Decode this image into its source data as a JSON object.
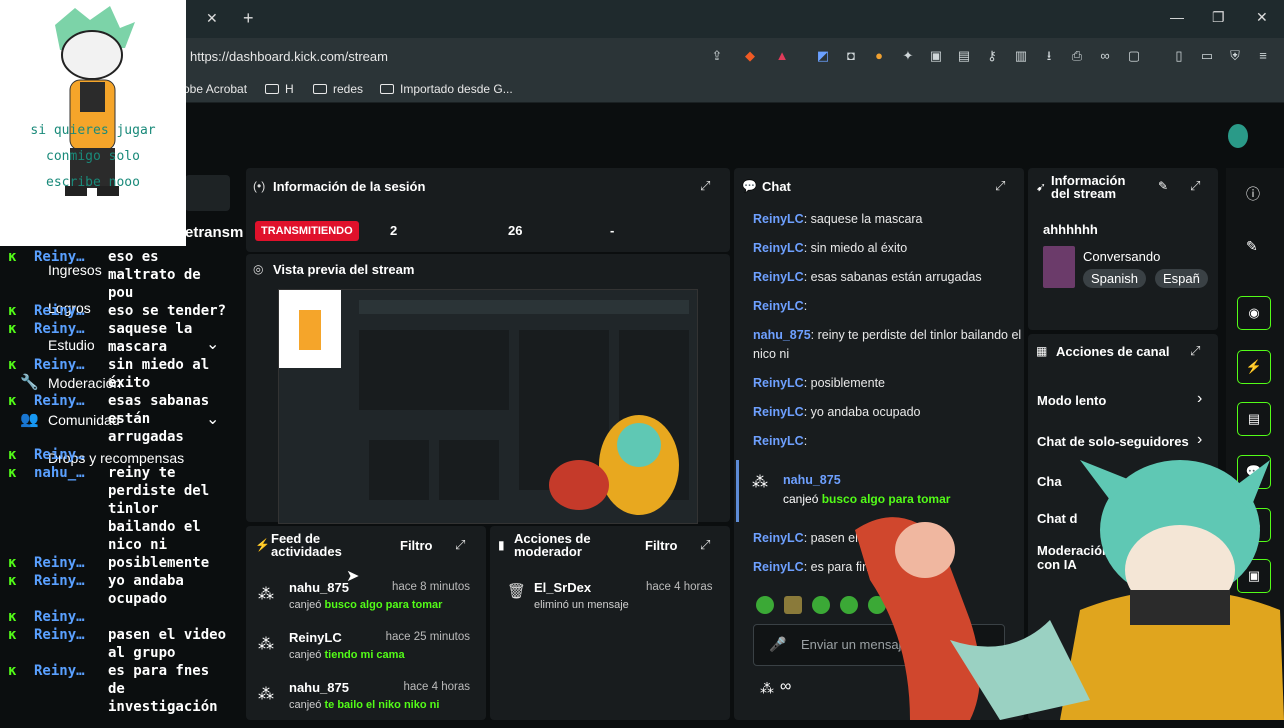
{
  "browser": {
    "url": "https://dashboard.kick.com/stream",
    "tab_close": "✕",
    "new_tab": "+",
    "bookmarks": [
      "obe Acrobat",
      "H",
      "redes",
      "Importado desde G..."
    ]
  },
  "avatar_overlay": {
    "caption_line1": "si quieres jugar",
    "caption_line2": "conmigo solo",
    "caption_line3": "escribe nooo"
  },
  "sidebar": {
    "partial_label": "etransm",
    "items": [
      {
        "label": "Ingresos"
      },
      {
        "label": "Logros"
      },
      {
        "label": "Estudio"
      },
      {
        "label": "Moderación"
      },
      {
        "label": "Comunidad"
      },
      {
        "label": "Drops y recompensas"
      }
    ]
  },
  "overlay_chat": [
    {
      "name": "Reiny…",
      "text": "eso es"
    },
    {
      "name": "",
      "text": "maltrato de"
    },
    {
      "name": "",
      "text": "pou"
    },
    {
      "name": "Reiny…",
      "text": "eso se tender?"
    },
    {
      "name": "Reiny…",
      "text": "saquese la"
    },
    {
      "name": "",
      "text": "mascara"
    },
    {
      "name": "Reiny…",
      "text": "sin miedo al"
    },
    {
      "name": "",
      "text": "éxito"
    },
    {
      "name": "Reiny…",
      "text": "esas sabanas"
    },
    {
      "name": "",
      "text": "están"
    },
    {
      "name": "",
      "text": "arrugadas"
    },
    {
      "name": "Reiny…",
      "text": ""
    },
    {
      "name": "nahu_…",
      "text": "reiny te"
    },
    {
      "name": "",
      "text": "perdiste del"
    },
    {
      "name": "",
      "text": "tinlor"
    },
    {
      "name": "",
      "text": "bailando el"
    },
    {
      "name": "",
      "text": "nico ni"
    },
    {
      "name": "Reiny…",
      "text": "posiblemente"
    },
    {
      "name": "Reiny…",
      "text": "yo andaba"
    },
    {
      "name": "",
      "text": "ocupado"
    },
    {
      "name": "Reiny…",
      "text": ""
    },
    {
      "name": "Reiny…",
      "text": "pasen el video"
    },
    {
      "name": "",
      "text": "al grupo"
    },
    {
      "name": "Reiny…",
      "text": "es para fnes"
    },
    {
      "name": "",
      "text": "de"
    },
    {
      "name": "",
      "text": "investigación"
    }
  ],
  "session": {
    "title": "Información de la sesión",
    "live_badge": "TRANSMITIENDO",
    "stat1": "2",
    "stat2": "26",
    "stat3": "-"
  },
  "preview": {
    "title": "Vista previa del stream"
  },
  "activity_feed": {
    "title_line1": "Feed de",
    "title_line2": "actividades",
    "filter": "Filtro",
    "items": [
      {
        "name": "nahu_875",
        "time": "hace 8 minutos",
        "sub": "canjeó",
        "reward": "busco algo para tomar"
      },
      {
        "name": "ReinyLC",
        "time": "hace 25 minutos",
        "sub": "canjeó",
        "reward": "tiendo mi cama"
      },
      {
        "name": "nahu_875",
        "time": "hace 4 horas",
        "sub": "canjeó",
        "reward": "te bailo el niko niko ni"
      }
    ]
  },
  "mod_actions": {
    "title_line1": "Acciones de",
    "title_line2": "moderador",
    "filter": "Filtro",
    "items": [
      {
        "name": "El_SrDex",
        "time": "hace 4 horas",
        "sub": "eliminó un mensaje"
      }
    ]
  },
  "chat": {
    "title": "Chat",
    "messages": [
      {
        "user": "ReinyLC",
        "text": ": saquese la mascara"
      },
      {
        "user": "ReinyLC",
        "text": ": sin miedo al éxito"
      },
      {
        "user": "ReinyLC",
        "text": ": esas sabanas están arrugadas"
      },
      {
        "user": "ReinyLC",
        "text": ":"
      },
      {
        "user": "nahu_875",
        "text": ": reiny te perdiste del tinlor bailando el nico ni"
      },
      {
        "user": "ReinyLC",
        "text": ": posiblemente"
      },
      {
        "user": "ReinyLC",
        "text": ": yo andaba ocupado"
      },
      {
        "user": "ReinyLC",
        "text": ":"
      }
    ],
    "redeem": {
      "user": "nahu_875",
      "text": "canjeó",
      "reward": "busco algo para tomar"
    },
    "messages2": [
      {
        "user": "ReinyLC",
        "text": ": pasen el vid"
      },
      {
        "user": "ReinyLC",
        "text": ": es para fin"
      }
    ],
    "input_placeholder": "Enviar un mensaje",
    "points": "∞"
  },
  "stream_info": {
    "title_line1": "Información",
    "title_line2": "del stream",
    "stream_title": "ahhhhhh",
    "category": "Conversando",
    "tags": [
      "Spanish",
      "Españ"
    ]
  },
  "channel_actions": {
    "title": "Acciones de canal",
    "rows": [
      "Modo lento",
      "Chat de solo-seguidores",
      "Cha",
      "Chat d",
      "Moderación con IA"
    ]
  },
  "colors": {
    "accent": "#53fc18",
    "live": "#e0112b",
    "username": "#6ea0ff"
  }
}
